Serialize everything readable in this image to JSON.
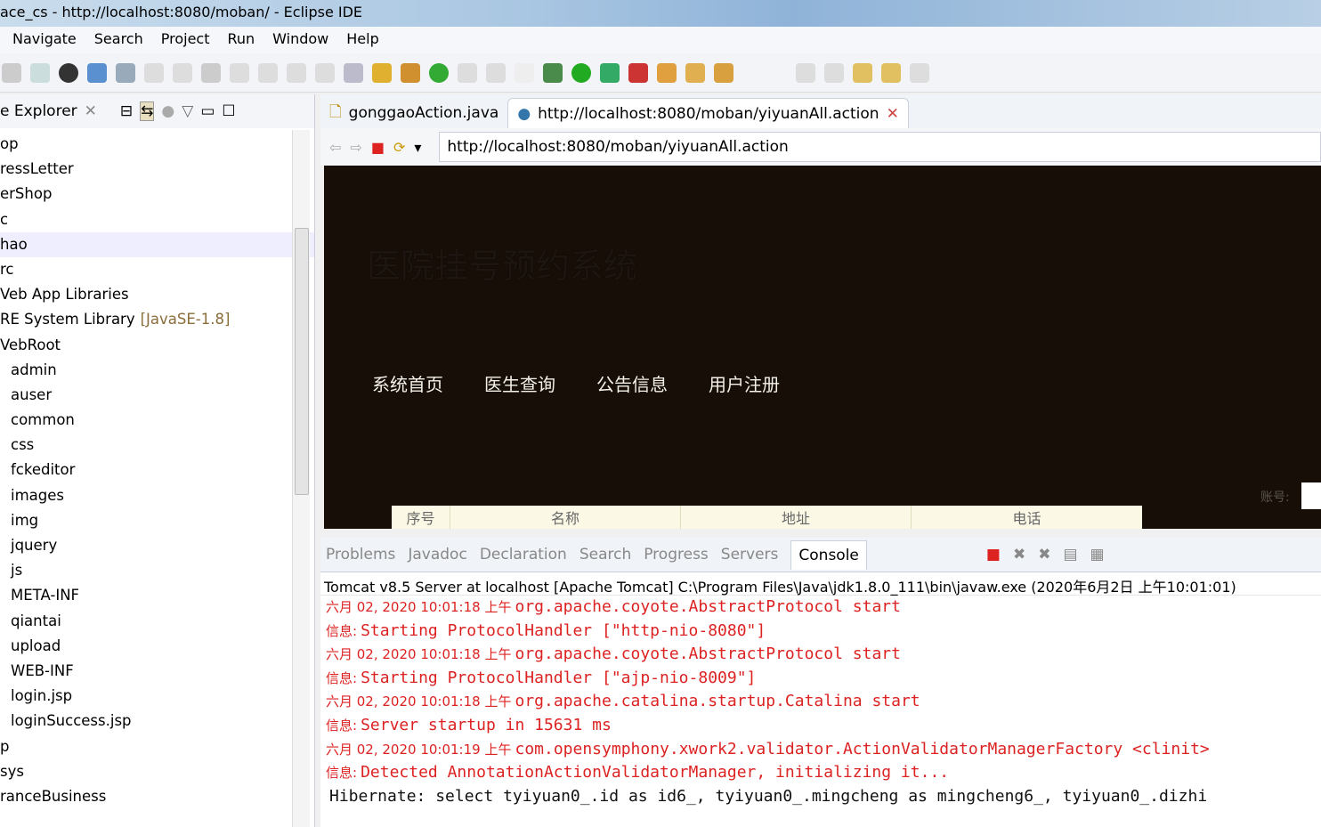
{
  "window": {
    "title": "ace_cs - http://localhost:8080/moban/ - Eclipse IDE"
  },
  "menu": [
    "Navigate",
    "Search",
    "Project",
    "Run",
    "Window",
    "Help"
  ],
  "explorer": {
    "title": "e Explorer",
    "items": [
      {
        "label": "op"
      },
      {
        "label": "ressLetter"
      },
      {
        "label": "erShop"
      },
      {
        "label": "c"
      },
      {
        "label": "hao"
      },
      {
        "label": "rc"
      },
      {
        "label": "Veb App Libraries"
      },
      {
        "label": "RE System Library",
        "suffix": "[JavaSE-1.8]"
      },
      {
        "label": "VebRoot"
      },
      {
        "label": "admin"
      },
      {
        "label": "auser"
      },
      {
        "label": "common"
      },
      {
        "label": "css"
      },
      {
        "label": "fckeditor"
      },
      {
        "label": "images"
      },
      {
        "label": "img"
      },
      {
        "label": "jquery"
      },
      {
        "label": "js"
      },
      {
        "label": "META-INF"
      },
      {
        "label": "qiantai"
      },
      {
        "label": "upload"
      },
      {
        "label": "WEB-INF"
      },
      {
        "label": "login.jsp"
      },
      {
        "label": "loginSuccess.jsp"
      },
      {
        "label": "p"
      },
      {
        "label": "sys"
      },
      {
        "label": "ranceBusiness"
      }
    ]
  },
  "editor_tabs": [
    {
      "label": "gonggaoAction.java"
    },
    {
      "label": "http://localhost:8080/moban/yiyuanAll.action"
    }
  ],
  "browser": {
    "url": "http://localhost:8080/moban/yiyuanAll.action",
    "site_title": "医院挂号预约系统",
    "nav": [
      "系统首页",
      "医生查询",
      "公告信息",
      "用户注册"
    ],
    "account_label": "账号:",
    "table_headers": [
      "序号",
      "名称",
      "地址",
      "电话"
    ]
  },
  "bottom_tabs": [
    "Problems",
    "Javadoc",
    "Declaration",
    "Search",
    "Progress",
    "Servers",
    "Console"
  ],
  "console": {
    "header": "Tomcat v8.5 Server at localhost [Apache Tomcat] C:\\Program Files\\Java\\jdk1.8.0_111\\bin\\javaw.exe (2020年6月2日 上午10:01:01)",
    "lines": [
      {
        "date": "六月 02, 2020 10:01:18 上午",
        "text": "org.apache.coyote.AbstractProtocol start"
      },
      {
        "date": "信息:",
        "text": "Starting ProtocolHandler [\"http-nio-8080\"]"
      },
      {
        "date": "六月 02, 2020 10:01:18 上午",
        "text": "org.apache.coyote.AbstractProtocol start"
      },
      {
        "date": "信息:",
        "text": "Starting ProtocolHandler [\"ajp-nio-8009\"]"
      },
      {
        "date": "六月 02, 2020 10:01:18 上午",
        "text": "org.apache.catalina.startup.Catalina start"
      },
      {
        "date": "信息:",
        "text": "Server startup in 15631 ms"
      },
      {
        "date": "六月 02, 2020 10:01:19 上午",
        "text": "com.opensymphony.xwork2.validator.ActionValidatorManagerFactory <clinit>"
      },
      {
        "date": "信息:",
        "text": "Detected AnnotationActionValidatorManager, initializing it..."
      },
      {
        "date": "",
        "text": "Hibernate: select tyiyuan0_.id as id6_, tyiyuan0_.mingcheng as mingcheng6_, tyiyuan0_.dizhi"
      }
    ]
  }
}
